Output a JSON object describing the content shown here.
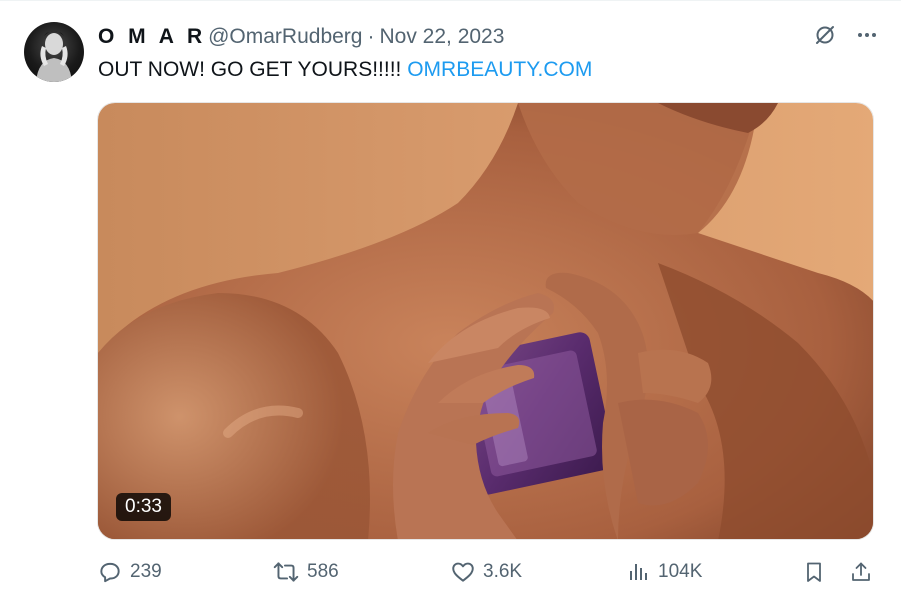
{
  "author": {
    "display_name": "O M A R",
    "handle": "@OmarRudberg",
    "separator": "·",
    "date": "Nov 22, 2023"
  },
  "tweet": {
    "text": "OUT NOW! GO GET YOURS!!!!! ",
    "link_text": "OMRBEAUTY.COM"
  },
  "media": {
    "duration": "0:33"
  },
  "actions": {
    "replies": "239",
    "reposts": "586",
    "likes": "3.6K",
    "views": "104K"
  },
  "icons": {
    "grok": "grok-icon",
    "more": "more-icon",
    "reply": "reply-icon",
    "repost": "repost-icon",
    "like": "heart-icon",
    "views": "views-icon",
    "bookmark": "bookmark-icon",
    "share": "share-icon"
  },
  "colors": {
    "link": "#1d9bf0",
    "muted": "#536471",
    "text": "#0f1419"
  }
}
